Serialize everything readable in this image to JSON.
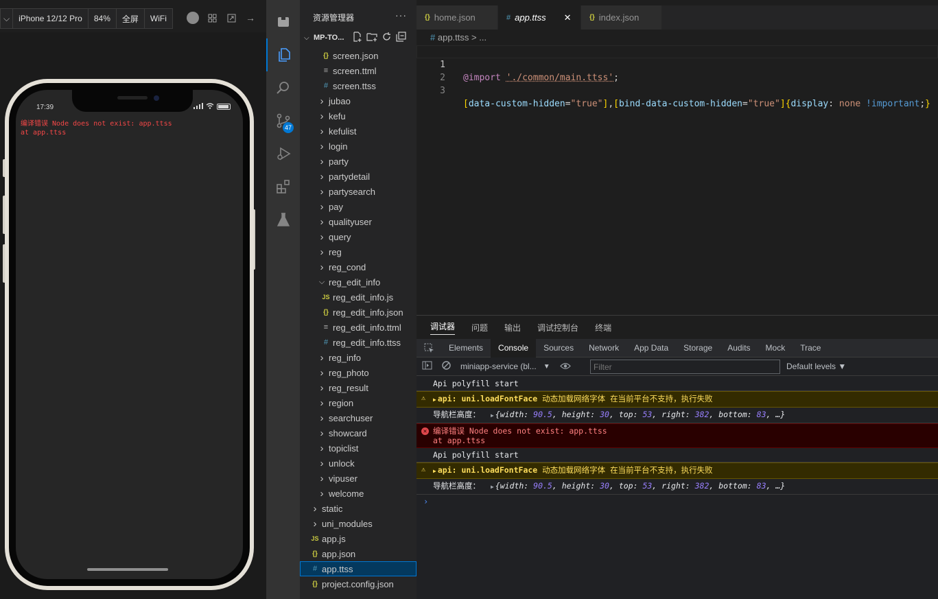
{
  "simulator": {
    "device": "iPhone 12/12 Pro",
    "zoom": "84%",
    "fullscreen": "全屏",
    "network": "WiFi",
    "status_time": "17:39",
    "error_line1": "编译错误 Node does not exist: app.ttss",
    "error_line2": "at app.ttss"
  },
  "activity": {
    "scm_badge": "47"
  },
  "explorer": {
    "title": "资源管理器",
    "more": "···",
    "project": "MP-TO...",
    "items": [
      {
        "label": "screen.json",
        "icon": "json",
        "level": 2
      },
      {
        "label": "screen.ttml",
        "icon": "lines",
        "level": 2
      },
      {
        "label": "screen.ttss",
        "icon": "hash",
        "level": 2
      },
      {
        "label": "jubao",
        "icon": "chev-right",
        "level": 1
      },
      {
        "label": "kefu",
        "icon": "chev-right",
        "level": 1
      },
      {
        "label": "kefulist",
        "icon": "chev-right",
        "level": 1
      },
      {
        "label": "login",
        "icon": "chev-right",
        "level": 1
      },
      {
        "label": "party",
        "icon": "chev-right",
        "level": 1
      },
      {
        "label": "partydetail",
        "icon": "chev-right",
        "level": 1
      },
      {
        "label": "partysearch",
        "icon": "chev-right",
        "level": 1
      },
      {
        "label": "pay",
        "icon": "chev-right",
        "level": 1
      },
      {
        "label": "qualityuser",
        "icon": "chev-right",
        "level": 1
      },
      {
        "label": "query",
        "icon": "chev-right",
        "level": 1
      },
      {
        "label": "reg",
        "icon": "chev-right",
        "level": 1
      },
      {
        "label": "reg_cond",
        "icon": "chev-right",
        "level": 1
      },
      {
        "label": "reg_edit_info",
        "icon": "chev-down",
        "level": 1
      },
      {
        "label": "reg_edit_info.js",
        "icon": "js",
        "level": 2
      },
      {
        "label": "reg_edit_info.json",
        "icon": "json",
        "level": 2
      },
      {
        "label": "reg_edit_info.ttml",
        "icon": "lines",
        "level": 2
      },
      {
        "label": "reg_edit_info.ttss",
        "icon": "hash",
        "level": 2
      },
      {
        "label": "reg_info",
        "icon": "chev-right",
        "level": 1
      },
      {
        "label": "reg_photo",
        "icon": "chev-right",
        "level": 1
      },
      {
        "label": "reg_result",
        "icon": "chev-right",
        "level": 1
      },
      {
        "label": "region",
        "icon": "chev-right",
        "level": 1
      },
      {
        "label": "searchuser",
        "icon": "chev-right",
        "level": 1
      },
      {
        "label": "showcard",
        "icon": "chev-right",
        "level": 1
      },
      {
        "label": "topiclist",
        "icon": "chev-right",
        "level": 1
      },
      {
        "label": "unlock",
        "icon": "chev-right",
        "level": 1
      },
      {
        "label": "vipuser",
        "icon": "chev-right",
        "level": 1
      },
      {
        "label": "welcome",
        "icon": "chev-right",
        "level": 1
      },
      {
        "label": "static",
        "icon": "chev-right",
        "level": 0
      },
      {
        "label": "uni_modules",
        "icon": "chev-right",
        "level": 0
      },
      {
        "label": "app.js",
        "icon": "js",
        "level": 0
      },
      {
        "label": "app.json",
        "icon": "json",
        "level": 0
      },
      {
        "label": "app.ttss",
        "icon": "hash",
        "level": 0,
        "selected": true
      },
      {
        "label": "project.config.json",
        "icon": "json",
        "level": 0
      }
    ]
  },
  "editor": {
    "tabs": [
      {
        "label": "home.json",
        "icon": "{}",
        "active": false
      },
      {
        "label": "app.ttss",
        "icon": "#",
        "active": true
      },
      {
        "label": "index.json",
        "icon": "{}",
        "active": false
      }
    ],
    "breadcrumb_file": "app.ttss",
    "breadcrumb_rest": "> ...",
    "line_numbers": [
      "1",
      "2",
      "3"
    ],
    "code": {
      "l1_at": "@import",
      "l1_str": "'./common/main.ttss'",
      "l1_end": ";",
      "l3_b1": "[",
      "l3_a1": "data-custom-hidden",
      "l3_eq1": "=",
      "l3_v1": "\"true\"",
      "l3_b2": "]",
      "l3_comma": ",",
      "l3_b3": "[",
      "l3_a2": "bind-data-custom-hidden",
      "l3_eq2": "=",
      "l3_v2": "\"true\"",
      "l3_b4": "]",
      "l3_br_open": "{",
      "l3_prop": "display",
      "l3_colon": ": ",
      "l3_none": "none",
      "l3_imp": " !important",
      "l3_semi": ";",
      "l3_br_close": "}"
    }
  },
  "devtools": {
    "top_tabs": [
      "调试器",
      "问题",
      "输出",
      "调试控制台",
      "终端"
    ],
    "tabs": [
      "Elements",
      "Console",
      "Sources",
      "Network",
      "App Data",
      "Storage",
      "Audits",
      "Mock",
      "Trace"
    ],
    "context": "miniapp-service (bl...",
    "filter_placeholder": "Filter",
    "levels": "Default levels ▼",
    "msg_polyfill": "Api polyfill start",
    "msg_warn_prefix": "api: uni.loadFontFace",
    "msg_warn_text": " 动态加载网络字体 在当前平台不支持，执行失败",
    "msg_nav_label": "导航栏高度：",
    "msg_nav_obj_width": "90.5",
    "msg_nav_obj_height": "30",
    "msg_nav_obj_top": "53",
    "msg_nav_obj_right": "382",
    "msg_nav_obj_bottom": "83",
    "msg_err_line1": "编译错误 Node does not exist: app.ttss",
    "msg_err_line2": "at app.ttss",
    "prompt": "›"
  }
}
